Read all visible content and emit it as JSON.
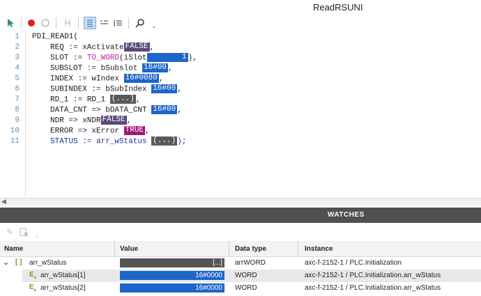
{
  "window": {
    "title": "ReadRSUNI"
  },
  "toolbar": {
    "buttons": [
      "cursor-arrow",
      "breakpoint-red",
      "breakpoint-empty",
      "step",
      "watch-toggle",
      "watch-list",
      "watch-expand",
      "search"
    ]
  },
  "editor": {
    "lines": [
      {
        "n": "1",
        "text": "PDI_READ1("
      },
      {
        "n": "2",
        "text": "REQ := xActivate",
        "val": "FALSE",
        "suffix": ","
      },
      {
        "n": "3",
        "text_a": "SLOT := ",
        "fn": "TO_WORD",
        "text_b": "(iSlot",
        "val": "1",
        "suffix": "),"
      },
      {
        "n": "4",
        "text": "SUBSLOT := bSubslot",
        "val": "16#00",
        "suffix": ","
      },
      {
        "n": "5",
        "text": "INDEX := wIndex",
        "val": "16#0080",
        "suffix": ","
      },
      {
        "n": "6",
        "text": "SUBINDEX := bSubIndex",
        "val": "16#00",
        "suffix": ","
      },
      {
        "n": "7",
        "text": "RD_1 := RD_1",
        "val": "(...)",
        "suffix": ","
      },
      {
        "n": "8",
        "text": "DATA_CNT => bDATA_CNT",
        "val": "16#00",
        "suffix": ","
      },
      {
        "n": "9",
        "text": "NDR => xNDR",
        "val": "FALSE",
        "suffix": ","
      },
      {
        "n": "10",
        "text": "ERROR => xError",
        "val": "TRUE",
        "suffix": ","
      },
      {
        "n": "11",
        "text": "STATUS := arr_wStatus",
        "val": "(...)",
        "suffix": ");"
      }
    ]
  },
  "watches": {
    "title": "WATCHES",
    "columns": [
      "Name",
      "Value",
      "Data type",
      "Instance"
    ],
    "rows": [
      {
        "name": "arr_wStatus",
        "value": "[...]",
        "type": "arrWORD",
        "instance": "axc-f-2152-1 / PLC.Initialization"
      },
      {
        "name": "arr_wStatus[1]",
        "value": "16#0000",
        "type": "WORD",
        "instance": "axc-f-2152-1 / PLC.Initialization.arr_wStatus"
      },
      {
        "name": "arr_wStatus[2]",
        "value": "16#0000",
        "type": "WORD",
        "instance": "axc-f-2152-1 / PLC.Initialization.arr_wStatus"
      }
    ]
  }
}
